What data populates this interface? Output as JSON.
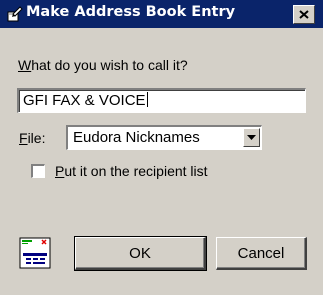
{
  "window": {
    "title": "Make Address Book Entry",
    "close_glyph": "✕"
  },
  "prompt": {
    "label_first": "W",
    "label_rest": "hat do you wish to call it?"
  },
  "name_field": {
    "value": "GFI FAX & VOICE"
  },
  "file": {
    "label_first": "F",
    "label_rest": "ile:",
    "selected": "Eudora Nicknames"
  },
  "recipient_option": {
    "label_first": "P",
    "label_rest": "ut it on the recipient list",
    "checked": false
  },
  "buttons": {
    "ok": "OK",
    "cancel": "Cancel"
  },
  "icons": {
    "title": "pencil-book-icon",
    "address_book": "address-book-icon"
  }
}
